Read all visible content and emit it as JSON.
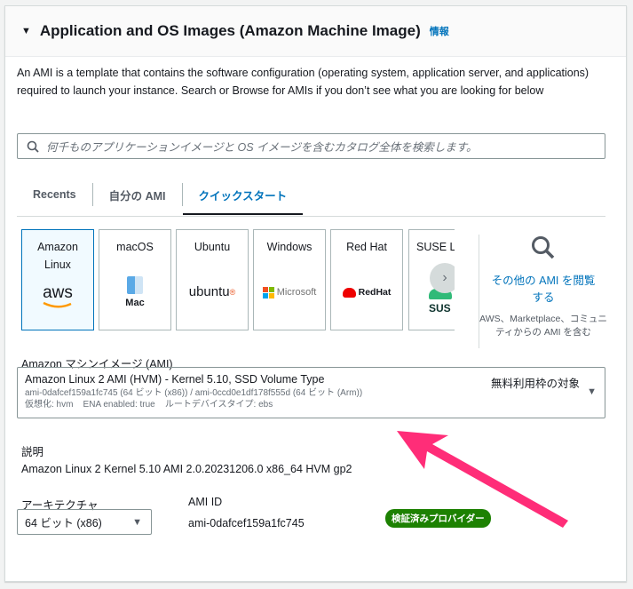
{
  "header": {
    "title": "Application and OS Images (Amazon Machine Image)",
    "info": "情報"
  },
  "description": "An AMI is a template that contains the software configuration (operating system, application server, and applications) required to launch your instance. Search or Browse for AMIs if you don’t see what you are looking for below",
  "search": {
    "placeholder": "何千ものアプリケーションイメージと OS イメージを含むカタログ全体を検索します。"
  },
  "tabs": [
    {
      "label": "Recents"
    },
    {
      "label": "自分の AMI"
    },
    {
      "label": "クイックスタート",
      "active": true
    }
  ],
  "tiles": [
    {
      "label": "Amazon Linux",
      "logo": "aws",
      "selected": true
    },
    {
      "label": "macOS",
      "logo": "Mac"
    },
    {
      "label": "Ubuntu",
      "logo": "ubuntu"
    },
    {
      "label": "Windows",
      "logo": "Microsoft"
    },
    {
      "label": "Red Hat",
      "logo": "RedHat"
    },
    {
      "label": "SUSE L",
      "logo": "SUS"
    }
  ],
  "other": {
    "link": "その他の AMI を閲覧する",
    "sub": "AWS、Marketplace、コミュニティからの AMI を含む"
  },
  "ami": {
    "label": "Amazon マシンイメージ (AMI)",
    "title": "Amazon Linux 2 AMI (HVM) - Kernel 5.10, SSD Volume Type",
    "free": "無料利用枠の対象",
    "ids": "ami-0dafcef159a1fc745 (64 ビット (x86)) / ami-0ccd0e1df178f555d (64 ビット (Arm))",
    "meta": "仮想化: hvm    ENA enabled: true    ルートデバイスタイプ: ebs"
  },
  "details": {
    "desc_label": "説明",
    "desc_value": "Amazon Linux 2 Kernel 5.10 AMI 2.0.20231206.0 x86_64 HVM gp2",
    "arch_label": "アーキテクチャ",
    "arch_value": "64 ビット (x86)",
    "amiid_label": "AMI ID",
    "amiid_value": "ami-0dafcef159a1fc745",
    "badge": "検証済みプロバイダー"
  },
  "colors": {
    "accent": "#0073bb",
    "badge": "#1d8102",
    "arrow": "#ff2d78"
  }
}
